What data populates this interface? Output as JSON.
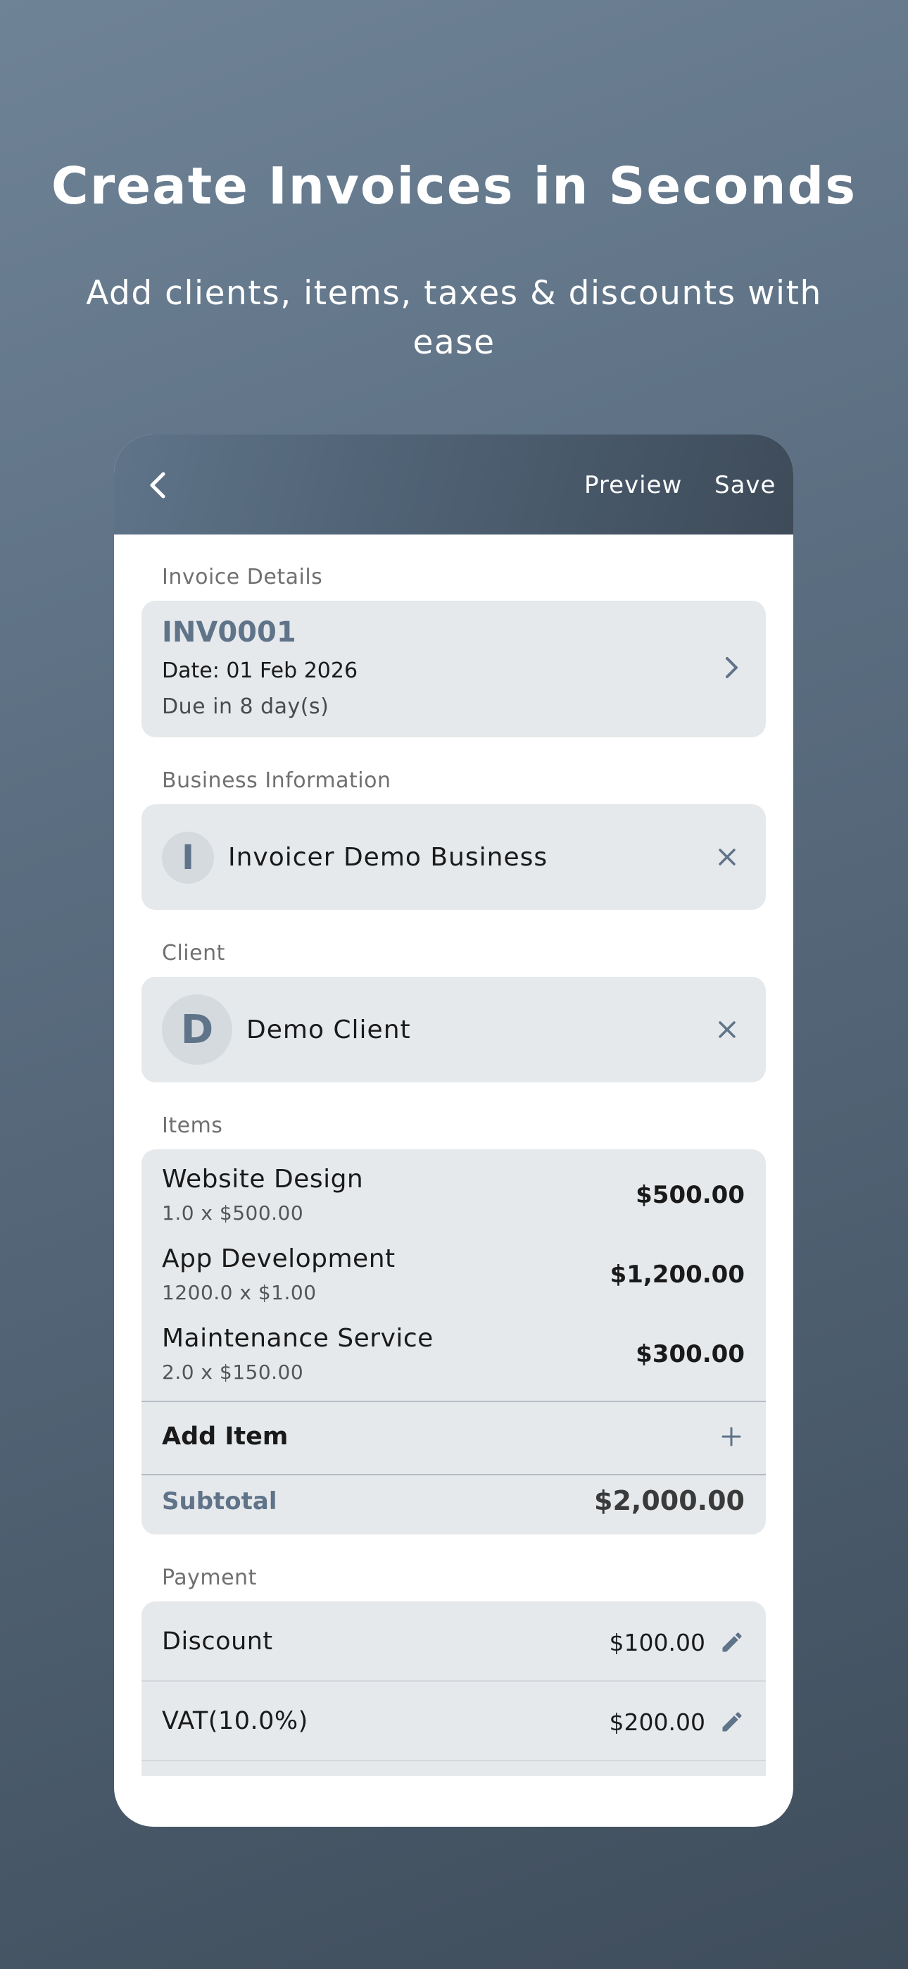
{
  "hero": {
    "title": "Create Invoices in Seconds",
    "subtitle": "Add clients, items, taxes & discounts with ease"
  },
  "appbar": {
    "back_icon": "chevron-left-icon",
    "preview_label": "Preview",
    "save_label": "Save"
  },
  "invoice_details": {
    "section_label": "Invoice Details",
    "number": "INV0001",
    "date": "Date: 01 Feb 2026",
    "due": "Due in 8 day(s)"
  },
  "business": {
    "section_label": "Business Information",
    "initial": "I",
    "name": "Invoicer Demo Business"
  },
  "client": {
    "section_label": "Client",
    "initial": "D",
    "name": "Demo Client"
  },
  "items": {
    "section_label": "Items",
    "list": [
      {
        "name": "Website Design",
        "detail": "1.0 x $500.00",
        "amount": "$500.00"
      },
      {
        "name": "App Development",
        "detail": "1200.0 x $1.00",
        "amount": "$1,200.00"
      },
      {
        "name": "Maintenance Service",
        "detail": "2.0 x $150.00",
        "amount": "$300.00"
      }
    ],
    "add_label": "Add Item",
    "subtotal_label": "Subtotal",
    "subtotal_value": "$2,000.00"
  },
  "payment": {
    "section_label": "Payment",
    "rows": [
      {
        "label": "Discount",
        "value": "$100.00"
      },
      {
        "label": "VAT(10.0%)",
        "value": "$200.00"
      }
    ]
  },
  "colors": {
    "accent": "#5f7389",
    "card_bg": "#e6e9ec",
    "appbar_start": "#5f7489",
    "appbar_end": "#3e4b59"
  }
}
